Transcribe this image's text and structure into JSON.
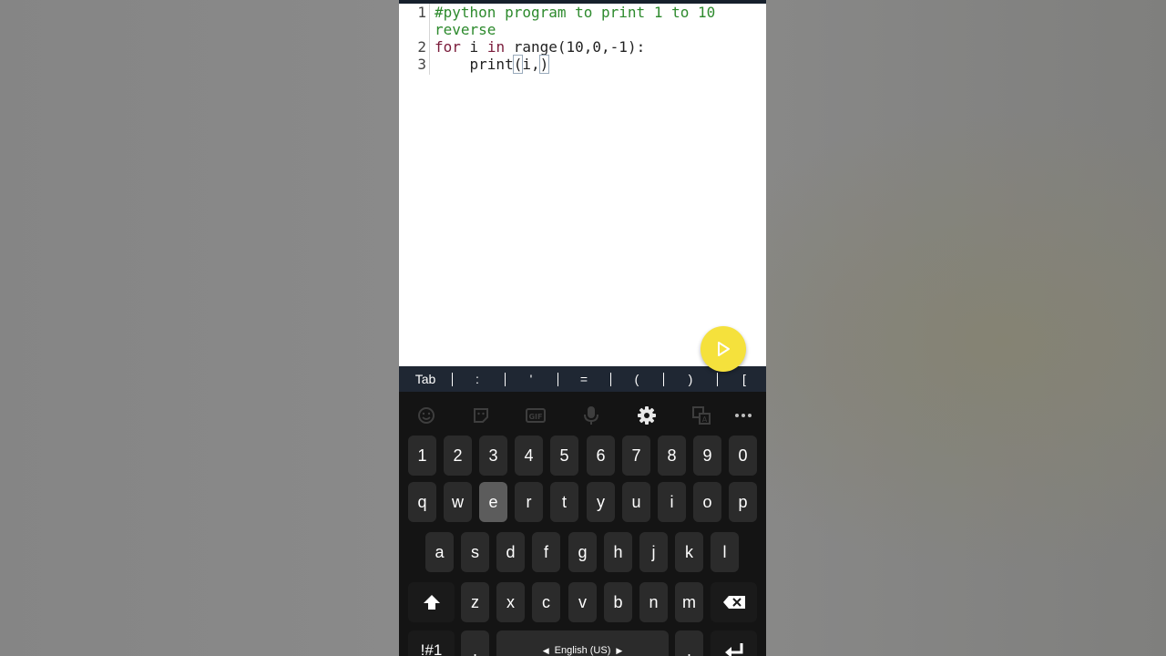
{
  "editor": {
    "lines": [
      {
        "num": "1",
        "text": "#python program to print 1 to 10"
      },
      {
        "num": "",
        "text": "reverse"
      },
      {
        "num": "2",
        "kw1": "for",
        "mid1": " i ",
        "kw2": "in",
        "rest": " range(10,0,-1):"
      },
      {
        "num": "3",
        "indent": "    print",
        "bopen": "(",
        "inner": "i,",
        "bclose": ")"
      }
    ]
  },
  "run_button": {
    "icon": "play-icon"
  },
  "symbol_bar": {
    "keys": [
      "Tab",
      ":",
      "'",
      "=",
      "(",
      ")",
      "["
    ]
  },
  "keyboard": {
    "toolbar": [
      "emoji-icon",
      "sticker-icon",
      "gif-icon",
      "microphone-icon",
      "gear-icon",
      "translate-icon",
      "more-icon"
    ],
    "number_row": [
      "1",
      "2",
      "3",
      "4",
      "5",
      "6",
      "7",
      "8",
      "9",
      "0"
    ],
    "row1": [
      "q",
      "w",
      "e",
      "r",
      "t",
      "y",
      "u",
      "i",
      "o",
      "p"
    ],
    "row2": [
      "a",
      "s",
      "d",
      "f",
      "g",
      "h",
      "j",
      "k",
      "l"
    ],
    "row3": [
      "z",
      "x",
      "c",
      "v",
      "b",
      "n",
      "m"
    ],
    "pressed_key": "e",
    "symbols_label": "!#1",
    "comma_label": ",",
    "space_label": "English (US)",
    "period_label": ".",
    "colors": {
      "background": "#141414",
      "key": "#2b2b2b",
      "pressed": "#5c5c5c",
      "accent": "#f5e13c"
    }
  }
}
